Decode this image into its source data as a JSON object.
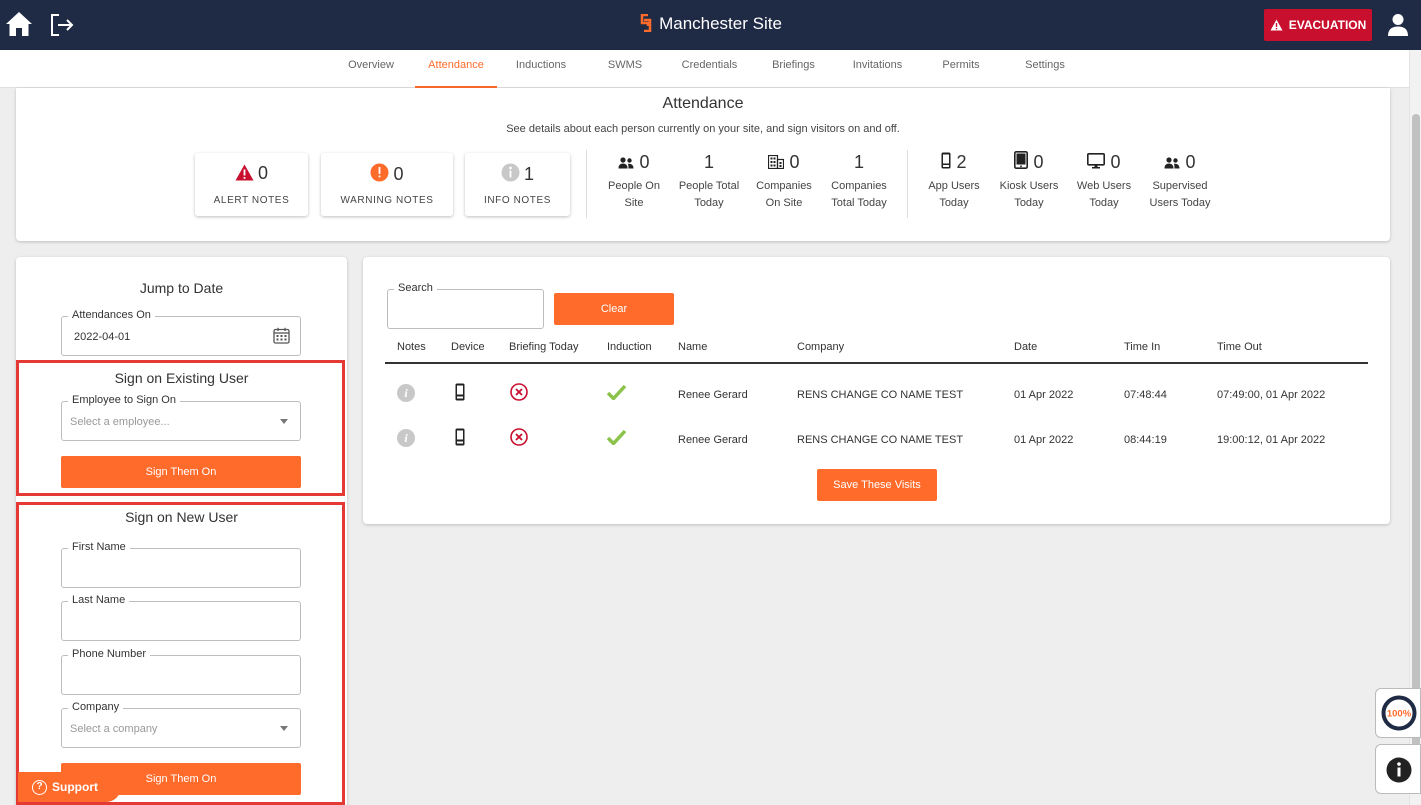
{
  "header": {
    "site_title": "Manchester Site",
    "evacuation_label": "EVACUATION",
    "icons": [
      "home-icon",
      "logout-icon",
      "warning-icon",
      "user-icon"
    ]
  },
  "tabs": [
    {
      "label": "Overview",
      "active": false
    },
    {
      "label": "Attendance",
      "active": true
    },
    {
      "label": "Inductions",
      "active": false
    },
    {
      "label": "SWMS",
      "active": false
    },
    {
      "label": "Credentials",
      "active": false
    },
    {
      "label": "Briefings",
      "active": false
    },
    {
      "label": "Invitations",
      "active": false
    },
    {
      "label": "Permits",
      "active": false
    },
    {
      "label": "Settings",
      "active": false
    }
  ],
  "summary": {
    "title": "Attendance",
    "subtitle": "See details about each person currently on your site, and sign visitors on and off.",
    "notes": [
      {
        "value": "0",
        "label": "ALERT NOTES",
        "icon": "alert-triangle-icon"
      },
      {
        "value": "0",
        "label": "WARNING NOTES",
        "icon": "warning-circle-icon"
      },
      {
        "value": "1",
        "label": "INFO NOTES",
        "icon": "info-circle-icon"
      }
    ],
    "stats": [
      {
        "value": "0",
        "label1": "People On",
        "label2": "Site",
        "icon": "people-icon"
      },
      {
        "value": "1",
        "label1": "People Total",
        "label2": "Today",
        "icon": ""
      },
      {
        "value": "0",
        "label1": "Companies",
        "label2": "On Site",
        "icon": "building-icon"
      },
      {
        "value": "1",
        "label1": "Companies",
        "label2": "Total Today",
        "icon": ""
      },
      {
        "value": "2",
        "label1": "App Users",
        "label2": "Today",
        "icon": "mobile-phone-icon"
      },
      {
        "value": "0",
        "label1": "Kiosk Users",
        "label2": "Today",
        "icon": "tablet-icon"
      },
      {
        "value": "0",
        "label1": "Web Users",
        "label2": "Today",
        "icon": "monitor-icon"
      },
      {
        "value": "0",
        "label1": "Supervised",
        "label2": "Users Today",
        "icon": "people-icon"
      }
    ]
  },
  "left": {
    "jump_title": "Jump to Date",
    "attendances_label": "Attendances On",
    "attendances_value": "2022-04-01",
    "existing_title": "Sign on Existing User",
    "employee_label": "Employee to Sign On",
    "employee_placeholder": "Select a employee...",
    "sign_on_label": "Sign Them On",
    "new_title": "Sign on New User",
    "first_name_label": "First Name",
    "last_name_label": "Last Name",
    "phone_label": "Phone Number",
    "company_label": "Company",
    "company_placeholder": "Select a company",
    "sign_on_label_2": "Sign Them On",
    "support_label": "Support"
  },
  "right": {
    "search_label": "Search",
    "clear_label": "Clear",
    "columns": [
      "Notes",
      "Device",
      "Briefing Today",
      "Induction",
      "Name",
      "Company",
      "Date",
      "Time In",
      "Time Out"
    ],
    "rows": [
      {
        "name": "Renee Gerard",
        "company": "RENS CHANGE CO NAME TEST",
        "date": "01 Apr 2022",
        "time_in": "07:48:44",
        "time_out": "07:49:00, 01 Apr 2022"
      },
      {
        "name": "Renee Gerard",
        "company": "RENS CHANGE CO NAME TEST",
        "date": "01 Apr 2022",
        "time_in": "08:44:19",
        "time_out": "19:00:12, 01 Apr 2022"
      }
    ],
    "save_label": "Save These Visits"
  },
  "widgets": {
    "progress_label": "100%",
    "progress_value": 1.0
  },
  "colors": {
    "header_bg": "#1f2a44",
    "accent": "#ff6b2b",
    "evacuation": "#c8102e",
    "highlight_box": "#e53935",
    "induction_ok": "#8bc34a",
    "briefing_missing": "#c8102e"
  }
}
